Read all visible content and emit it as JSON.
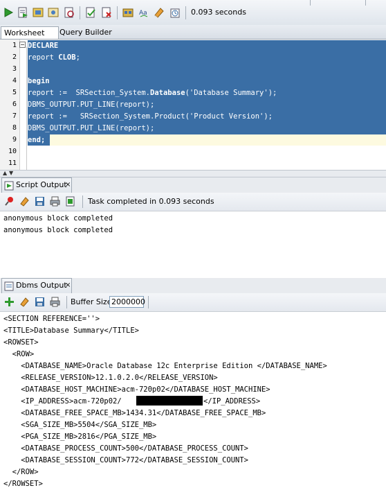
{
  "toolbar": {
    "elapsed": "0.093 seconds",
    "buttons": [
      "run-statement-icon",
      "run-script-icon",
      "autotrace-icon",
      "explain-plan-icon",
      "sql-tuning-icon",
      "commit-icon",
      "rollback-icon",
      "unshared-sql-icon",
      "to-upper-icon",
      "clear-icon",
      "history-icon"
    ]
  },
  "tabs": {
    "worksheet": "Worksheet",
    "query_builder": "Query Builder"
  },
  "editor": {
    "line_numbers": [
      "1",
      "2",
      "3",
      "4",
      "5",
      "6",
      "7",
      "8",
      "9",
      "10",
      "11"
    ],
    "lines": {
      "l1": "DECLARE",
      "l2a": "report ",
      "l2b": "CLOB",
      "l2c": ";",
      "l4": "begin",
      "l5a": "report :=  SRSection_System.",
      "l5b": "Database",
      "l5c": "('Database Summary');",
      "l6": "DBMS_OUTPUT.PUT_LINE(report);",
      "l7": "report :=   SRSection_System.Product('Product Version');",
      "l8": "DBMS_OUTPUT.PUT_LINE(report);",
      "l9": "end;"
    }
  },
  "script_output": {
    "tab": "Script Output",
    "close": "×",
    "status": "Task completed in 0.093 seconds",
    "lines": [
      "anonymous block completed",
      "anonymous block completed"
    ]
  },
  "dbms_output": {
    "tab": "Dbms Output",
    "close": "×",
    "buffer_label": "Buffer Size:",
    "buffer_value": "2000000",
    "lines": {
      "l1": "<SECTION REFERENCE=''>",
      "l2": "<TITLE>Database Summary</TITLE>",
      "l3": "<ROWSET>",
      "l4": "  <ROW>",
      "l5": "    <DATABASE_NAME>Oracle Database 12c Enterprise Edition </DATABASE_NAME>",
      "l6": "    <RELEASE_VERSION>12.1.0.2.0</RELEASE_VERSION>",
      "l7": "    <DATABASE_HOST_MACHINE>acm-720p02</DATABASE_HOST_MACHINE>",
      "l8a": "    <IP_ADDRESS>acm-720p02/",
      "l8b": "</IP_ADDRESS>",
      "l9": "    <DATABASE_FREE_SPACE_MB>1434.31</DATABASE_FREE_SPACE_MB>",
      "l10": "    <SGA_SIZE_MB>5504</SGA_SIZE_MB>",
      "l11": "    <PGA_SIZE_MB>2816</PGA_SIZE_MB>",
      "l12": "    <DATABASE_PROCESS_COUNT>500</DATABASE_PROCESS_COUNT>",
      "l13": "    <DATABASE_SESSION_COUNT>772</DATABASE_SESSION_COUNT>",
      "l14": "  </ROW>",
      "l15": "</ROWSET>"
    }
  },
  "colors": {
    "selection": "#3a6ea5",
    "current_line": "#fdfae0"
  }
}
